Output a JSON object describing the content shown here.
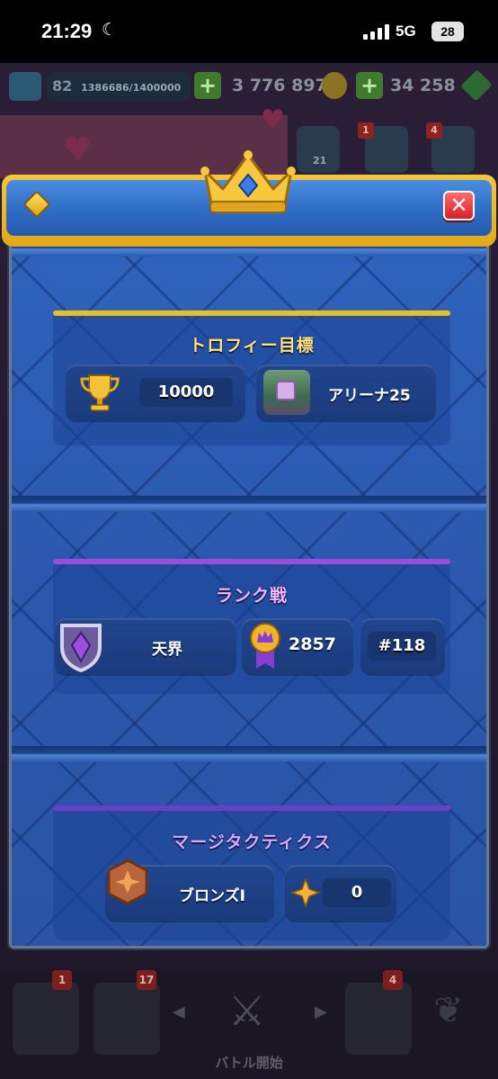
{
  "status_bar": {
    "time": "21:29",
    "network": "5G",
    "battery": "28"
  },
  "hud": {
    "level": "82",
    "xp": "1386686/1400000",
    "gold": "3 776 897",
    "gems": "34 258",
    "friends_count": "21",
    "news_badge": "1",
    "menu_badge": "4"
  },
  "modal": {
    "trophy_section": {
      "title": "トロフィー目標",
      "trophy_value": "10000",
      "arena_label": "アリーナ25"
    },
    "ranked_section": {
      "title": "ランク戦",
      "league_name": "天界",
      "medal_value": "2857",
      "rank_label": "#118"
    },
    "tactics_section": {
      "title": "マージタクティクス",
      "tier_label": "ブロンズI",
      "star_value": "0"
    }
  },
  "bottom_nav": {
    "shop_badge": "1",
    "cards_badge": "17",
    "battle_label": "バトル開始",
    "clan_badge": "4"
  },
  "colors": {
    "trophy_bar": "#e9c01f",
    "ranked_bar": "#9b4fd6",
    "tactics_bar": "#6d3dc9",
    "title_gold": "#ffe27a",
    "title_pink": "#f2b6ff",
    "title_violet": "#d9a8ff"
  }
}
